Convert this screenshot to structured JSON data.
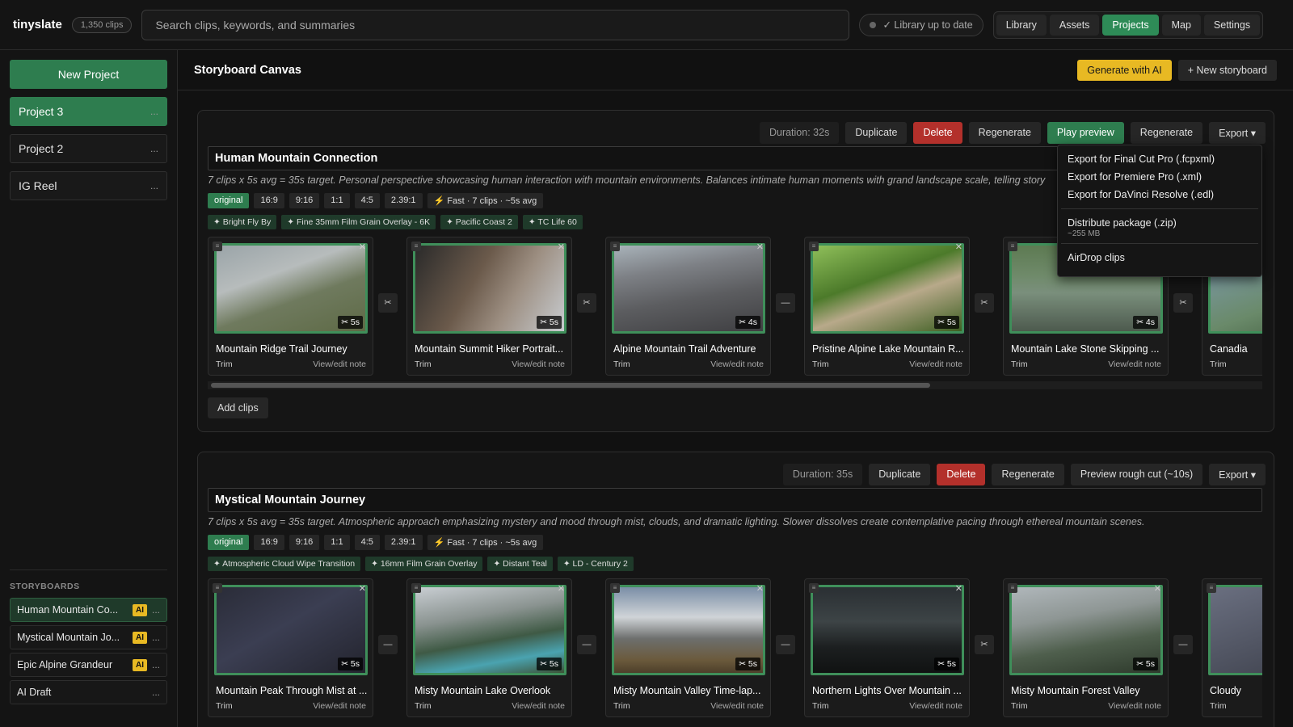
{
  "topbar": {
    "brand": "tinyslate",
    "clip_count": "1,350 clips",
    "search_placeholder": "Search clips, keywords, and summaries",
    "library_status": "✓ Library up to date",
    "nav": [
      "Library",
      "Assets",
      "Projects",
      "Map",
      "Settings"
    ],
    "active_nav": "Projects"
  },
  "sidebar": {
    "new_project": "New Project",
    "projects": [
      {
        "label": "Project 3",
        "more": "..."
      },
      {
        "label": "Project 2",
        "more": "..."
      },
      {
        "label": "IG Reel",
        "more": "..."
      }
    ],
    "storyboards_title": "STORYBOARDS",
    "storyboards": [
      {
        "label": "Human Mountain Co...",
        "badge": "AI",
        "more": "..."
      },
      {
        "label": "Mystical Mountain Jo...",
        "badge": "AI",
        "more": "..."
      },
      {
        "label": "Epic Alpine Grandeur",
        "badge": "AI",
        "more": "..."
      },
      {
        "label": "AI Draft",
        "badge": "",
        "more": "..."
      }
    ]
  },
  "main": {
    "title": "Storyboard Canvas",
    "generate_ai": "Generate with AI",
    "new_storyboard": "+ New storyboard"
  },
  "storyboard1": {
    "duration": "Duration: 32s",
    "duplicate": "Duplicate",
    "delete": "Delete",
    "regenerate": "Regenerate",
    "play_preview": "Play preview",
    "regenerate2": "Regenerate",
    "export": "Export ▾",
    "title": "Human Mountain Connection",
    "description": "7 clips x 5s avg = 35s target. Personal perspective showcasing human interaction with mountain environments. Balances intimate human moments with grand landscape scale, telling story",
    "aspect_chips": [
      "original",
      "16:9",
      "9:16",
      "1:1",
      "4:5",
      "2.39:1"
    ],
    "pace_chip": "⚡ Fast · 7 clips · ~5s avg",
    "effects": [
      "✦ Bright Fly By",
      "✦ Fine 35mm Film Grain Overlay - 6K",
      "✦ Pacific Coast 2",
      "✦ TC Life 60"
    ],
    "clips": [
      {
        "title": "Mountain Ridge Trail Journey",
        "duration": "✂ 5s",
        "trim": "Trim",
        "note": "View/edit note"
      },
      {
        "title": "Mountain Summit Hiker Portrait...",
        "duration": "✂ 5s",
        "trim": "Trim",
        "note": "View/edit note"
      },
      {
        "title": "Alpine Mountain Trail Adventure",
        "duration": "✂ 4s",
        "trim": "Trim",
        "note": "View/edit note"
      },
      {
        "title": "Pristine Alpine Lake Mountain R...",
        "duration": "✂ 5s",
        "trim": "Trim",
        "note": "View/edit note"
      },
      {
        "title": "Mountain Lake Stone Skipping ...",
        "duration": "✂ 4s",
        "trim": "Trim",
        "note": "View/edit note"
      },
      {
        "title": "Canadia",
        "duration": "",
        "trim": "Trim",
        "note": ""
      }
    ],
    "transitions": [
      "✂",
      "✂",
      "—",
      "✂",
      "✂"
    ],
    "add_clips": "Add clips"
  },
  "export_menu": {
    "items": [
      "Export for Final Cut Pro (.fcpxml)",
      "Export for Premiere Pro (.xml)",
      "Export for DaVinci Resolve (.edl)"
    ],
    "package": "Distribute package (.zip)",
    "package_size": "~255 MB",
    "airdrop": "AirDrop clips"
  },
  "storyboard2": {
    "duration": "Duration: 35s",
    "duplicate": "Duplicate",
    "delete": "Delete",
    "regenerate": "Regenerate",
    "preview": "Preview rough cut (~10s)",
    "export": "Export ▾",
    "title": "Mystical Mountain Journey",
    "description": "7 clips x 5s avg = 35s target. Atmospheric approach emphasizing mystery and mood through mist, clouds, and dramatic lighting. Slower dissolves create contemplative pacing through ethereal mountain scenes.",
    "aspect_chips": [
      "original",
      "16:9",
      "9:16",
      "1:1",
      "4:5",
      "2.39:1"
    ],
    "pace_chip": "⚡ Fast · 7 clips · ~5s avg",
    "effects": [
      "✦ Atmospheric Cloud Wipe Transition",
      "✦ 16mm Film Grain Overlay",
      "✦ Distant Teal",
      "✦ LD - Century 2"
    ],
    "clips": [
      {
        "title": "Mountain Peak Through Mist at ...",
        "duration": "✂ 5s",
        "trim": "Trim",
        "note": "View/edit note"
      },
      {
        "title": "Misty Mountain Lake Overlook",
        "duration": "✂ 5s",
        "trim": "Trim",
        "note": "View/edit note"
      },
      {
        "title": "Misty Mountain Valley Time-lap...",
        "duration": "✂ 5s",
        "trim": "Trim",
        "note": "View/edit note"
      },
      {
        "title": "Northern Lights Over Mountain ...",
        "duration": "✂ 5s",
        "trim": "Trim",
        "note": "View/edit note"
      },
      {
        "title": "Misty Mountain Forest Valley",
        "duration": "✂ 5s",
        "trim": "Trim",
        "note": "View/edit note"
      },
      {
        "title": "Cloudy",
        "duration": "",
        "trim": "Trim",
        "note": ""
      }
    ],
    "transitions": [
      "—",
      "—",
      "—",
      "✂",
      "—"
    ]
  }
}
